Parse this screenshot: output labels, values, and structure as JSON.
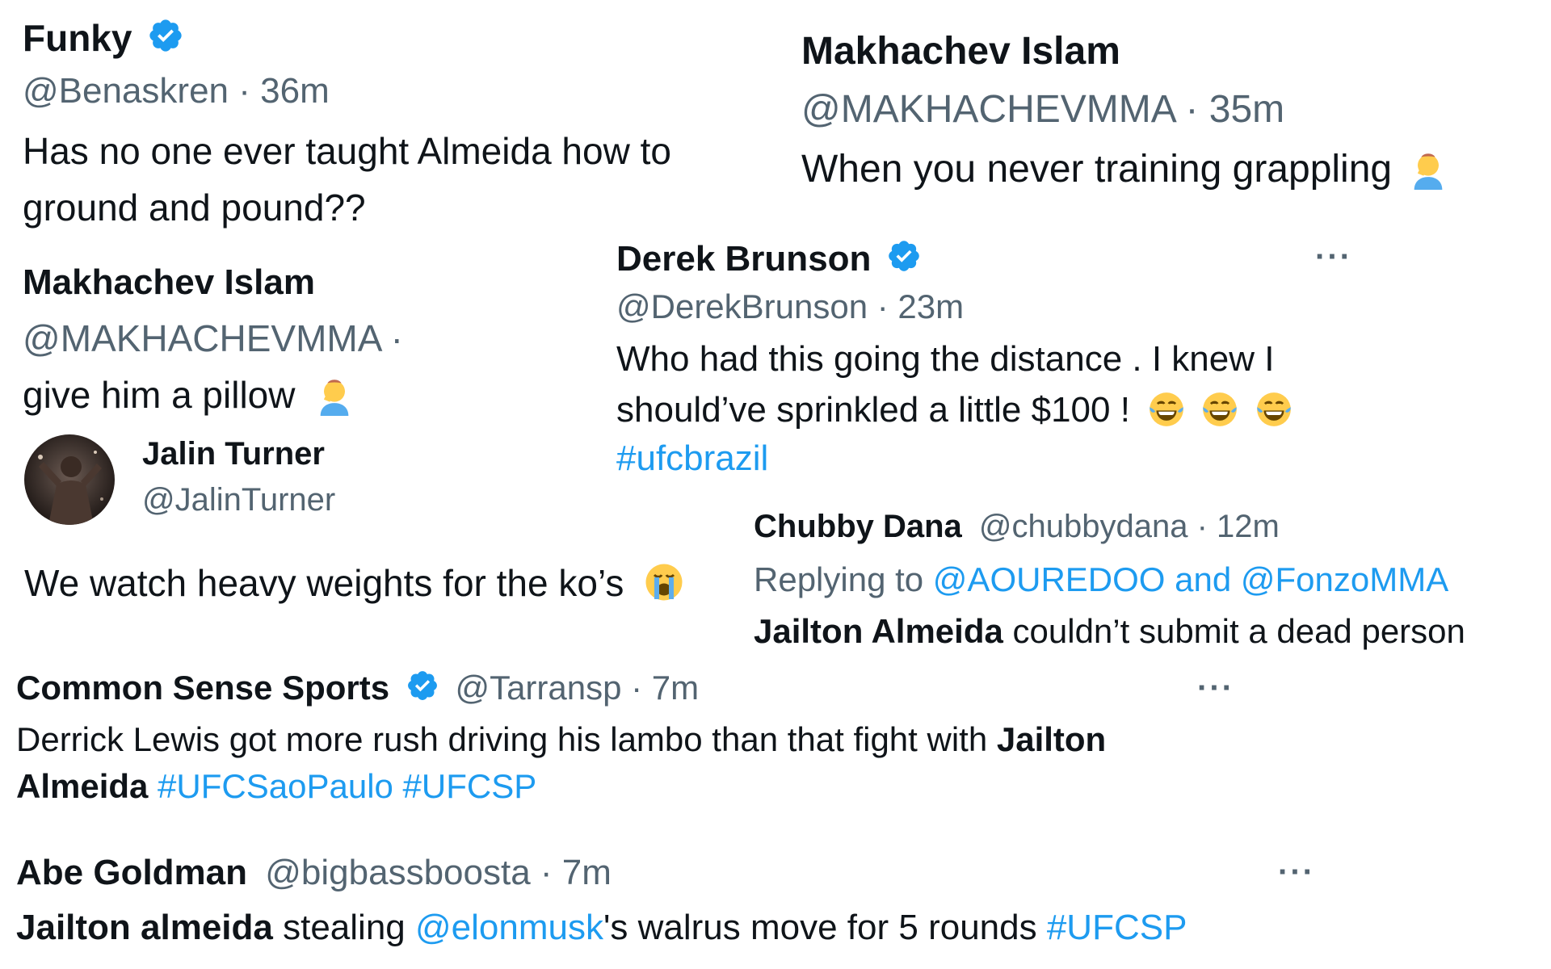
{
  "tweets": {
    "funky": {
      "name": "Funky",
      "handle_time": "@Benaskren · 36m",
      "text_line1": "Has no one ever taught Almeida how to",
      "text_line2": "ground and pound??"
    },
    "makhachev1": {
      "name": "Makhachev Islam",
      "handle_time": "@MAKHACHEVMMA · 35m",
      "text": "When you never training grappling",
      "emoji": "facepalm-emoji"
    },
    "brunson": {
      "name": "Derek Brunson",
      "handle_time": "@DerekBrunson · 23m",
      "more": "···",
      "text_line1": "Who had this going the distance . I knew I",
      "text_line2": "should’ve sprinkled a little $100 !",
      "emoji": "tears-of-joy-emoji",
      "hashtag": "#ufcbrazil"
    },
    "makhachev2": {
      "name": "Makhachev Islam",
      "handle": "@MAKHACHEVMMA ·",
      "text": "give him a pillow",
      "emoji": "facepalm-emoji"
    },
    "turner": {
      "name": "Jalin Turner",
      "handle": "@JalinTurner",
      "text": "We watch heavy weights for the ko’s",
      "emoji": "loudly-crying-emoji"
    },
    "dana": {
      "name": "Chubby Dana",
      "handle_time": "@chubbydana · 12m",
      "replying_prefix": "Replying to ",
      "replying_targets": "@AOUREDOO and @FonzoMMA",
      "text_bold": "Jailton Almeida",
      "text_rest": " couldn’t submit a dead person"
    },
    "commonsense": {
      "name": "Common Sense Sports",
      "handle_time": "@Tarransp · 7m",
      "more": "···",
      "line1_text": "Derrick Lewis got more rush driving his lambo than that fight with ",
      "line1_bold": "Jailton",
      "line2_bold": "Almeida",
      "line2_tags": " #UFCSaoPaulo #UFCSP"
    },
    "abe": {
      "name": "Abe Goldman",
      "handle_time": "@bigbassboosta · 7m",
      "more": "···",
      "text_bold": "Jailton almeida",
      "text_mid": " stealing ",
      "mention": "@elonmusk",
      "text_end": "'s walrus move for 5 rounds ",
      "hashtag": "#UFCSP"
    }
  },
  "colors": {
    "text": "#0f1419",
    "muted": "#536471",
    "link": "#1d9bf0",
    "verified": "#1d9bf0"
  }
}
